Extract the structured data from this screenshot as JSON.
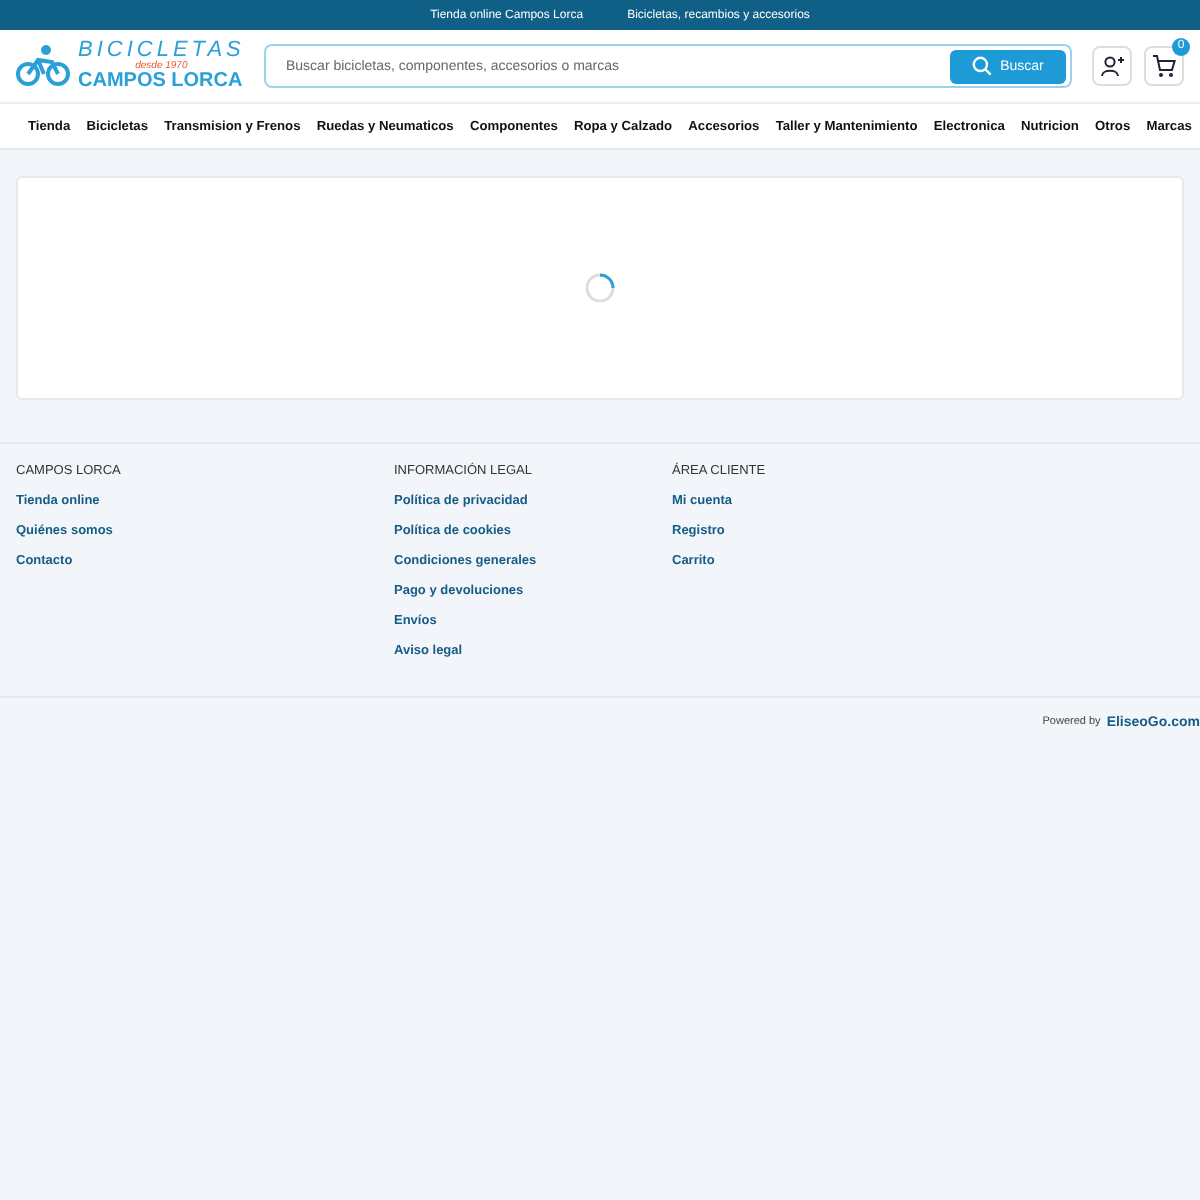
{
  "top_bar": [
    "Tienda online Campos Lorca",
    "Bicicletas, recambios y accesorios"
  ],
  "logo": {
    "title": "BICICLETAS",
    "since": "desde 1970",
    "name": "CAMPOS LORCA"
  },
  "search": {
    "placeholder": "Buscar bicicletas, componentes, accesorios o marcas",
    "button": "Buscar"
  },
  "cart": {
    "count": "0"
  },
  "nav": [
    "Tienda",
    "Bicicletas",
    "Transmision y Frenos",
    "Ruedas y Neumaticos",
    "Componentes",
    "Ropa y Calzado",
    "Accesorios",
    "Taller y Mantenimiento",
    "Electronica",
    "Nutricion",
    "Otros",
    "Marcas"
  ],
  "content": {
    "loading": true
  },
  "footer": {
    "columns": [
      {
        "title": "CAMPOS LORCA",
        "links": [
          "Tienda online",
          "Quiénes somos",
          "Contacto"
        ]
      },
      {
        "title": "INFORMACIÓN LEGAL",
        "links": [
          "Política de privacidad",
          "Política de cookies",
          "Condiciones generales",
          "Pago y devoluciones",
          "Envíos",
          "Aviso legal"
        ]
      },
      {
        "title": "ÁREA CLIENTE",
        "links": [
          "Mi cuenta",
          "Registro",
          "Carrito"
        ]
      }
    ],
    "powered_label": "Powered by",
    "powered_link": "EliseoGo.com"
  }
}
